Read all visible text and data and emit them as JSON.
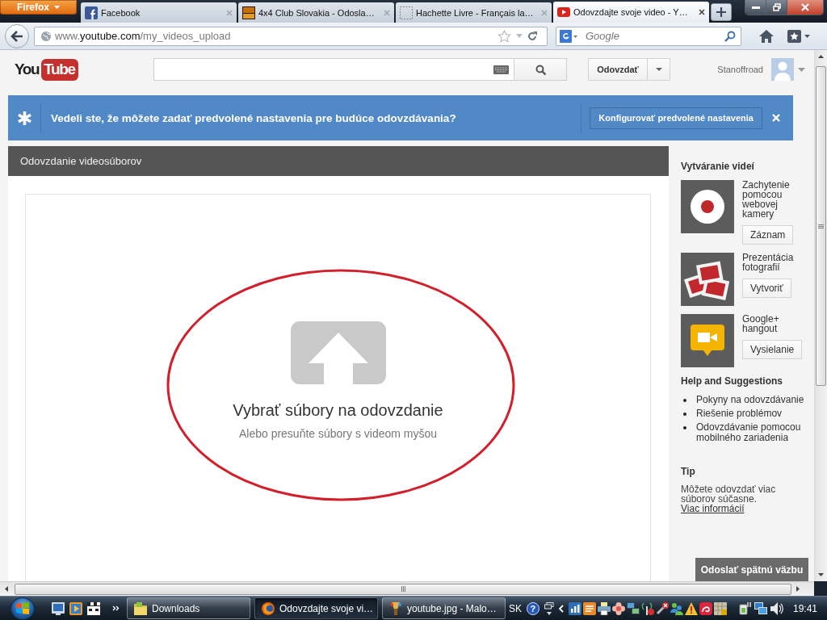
{
  "browser": {
    "menu_button": "Firefox",
    "tabs": [
      {
        "title": "Facebook",
        "kind": "facebook",
        "selected": false
      },
      {
        "title": "4x4 Club Slovakia - Odosla…",
        "kind": "club",
        "selected": false
      },
      {
        "title": "Hachette Livre - Français la…",
        "kind": "blank",
        "selected": false
      },
      {
        "title": "Odovzdajte svoje video - Y…",
        "kind": "youtube",
        "selected": true
      }
    ],
    "address": {
      "prefix": "www.",
      "host": "youtube.com",
      "path": "/my_videos_upload"
    },
    "search": {
      "placeholder": "Google"
    }
  },
  "header": {
    "logo": {
      "left": "You",
      "right": "Tube"
    },
    "upload_button": "Odovzdať",
    "user_name": "Stanoffroad"
  },
  "banner": {
    "message": "Vedeli ste, že môžete zadať predvolené nastavenia pre budúce odovzdávania?",
    "button": "Konfigurovať predvolené nastavenia"
  },
  "upload_panel": {
    "title": "Odovzdanie videosúborov",
    "heading": "Vybrať súbory na odovzdanie",
    "subtext": "Alebo presuňte súbory s videom myšou"
  },
  "sidebar": {
    "create_title": "Vytváranie videí",
    "create_items": [
      {
        "kind": "webcam",
        "label": "Zachytenie pomocou webovej kamery",
        "button": "Záznam"
      },
      {
        "kind": "photos",
        "label": "Prezentácia fotografií",
        "button": "Vytvoriť"
      },
      {
        "kind": "hangout",
        "label": "Google+ hangout",
        "button": "Vysielanie"
      }
    ],
    "help_title": "Help and Suggestions",
    "help_links": [
      "Pokyny na odovzdávanie",
      "Riešenie problémov",
      "Odovzdávanie pomocou mobilného zariadenia"
    ],
    "tip_title": "Tip",
    "tip_text": "Môžete odovzdať viac súborov súčasne.",
    "tip_link": "Viac informácií"
  },
  "feedback_button": "Odoslať spätnú väzbu",
  "taskbar": {
    "tasks": [
      {
        "label": "Downloads",
        "kind": "folder",
        "selected": false
      },
      {
        "label": "Odovzdajte svoje vi…",
        "kind": "firefox",
        "selected": true
      },
      {
        "label": "youtube.jpg - Malo…",
        "kind": "paint",
        "selected": false
      }
    ],
    "language": "SK",
    "help": "?",
    "clock": "19:41"
  }
}
